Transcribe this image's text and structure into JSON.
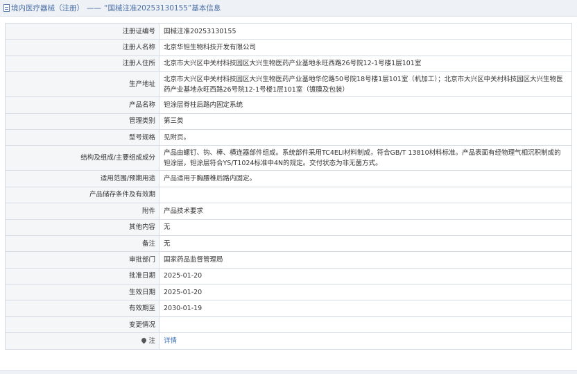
{
  "header": {
    "icon": "document-icon",
    "category": "境内医疗器械（注册）",
    "separator": "——",
    "record_title": "“国械注准20253130155”基本信息"
  },
  "rows": [
    {
      "label": "注册证编号",
      "value": "国械注准20253130155"
    },
    {
      "label": "注册人名称",
      "value": "北京华钽生物科技开发有限公司"
    },
    {
      "label": "注册人住所",
      "value": "北京市大兴区中关村科技园区大兴生物医药产业基地永旺西路26号院12-1号楼1层101室"
    },
    {
      "label": "生产地址",
      "value": "北京市大兴区中关村科技园区大兴生物医药产业基地华佗路50号院18号楼1层101室（机加工）；北京市大兴区中关村科技园区大兴生物医药产业基地永旺西路26号院12-1号楼1层101室（镀膜及包装）"
    },
    {
      "label": "产品名称",
      "value": "钽涂层脊柱后路内固定系统"
    },
    {
      "label": "管理类别",
      "value": "第三类"
    },
    {
      "label": "型号规格",
      "value": "见附页。"
    },
    {
      "label": "结构及组成/主要组成成分",
      "value": "产品由螺钉、钩、棒、横连器部件组成。系统部件采用TC4ELI材料制成，符合GB/T 13810材料标准。产品表面有经物理气相沉积制成的钽涂层，钽涂层符合YS/T1024标准中4N的规定。交付状态为非无菌方式。"
    },
    {
      "label": "适用范围/预期用途",
      "value": "产品适用于胸腰椎后路内固定。"
    },
    {
      "label": "产品储存条件及有效期",
      "value": ""
    },
    {
      "label": "附件",
      "value": "产品技术要求"
    },
    {
      "label": "其他内容",
      "value": "无"
    },
    {
      "label": "备注",
      "value": "无"
    },
    {
      "label": "审批部门",
      "value": "国家药品监督管理局"
    },
    {
      "label": "批准日期",
      "value": "2025-01-20"
    },
    {
      "label": "生效日期",
      "value": "2025-01-20"
    },
    {
      "label": "有效期至",
      "value": "2030-01-19"
    },
    {
      "label": "变更情况",
      "value": ""
    }
  ],
  "note_row": {
    "icon": "map-pin-icon",
    "label": "注",
    "link_text": "详情"
  },
  "colors": {
    "header_bg": "#eef1f6",
    "header_text": "#4a6fa5",
    "label_bg": "#f5f6f8",
    "border": "#d6dbe3",
    "link": "#3a6fb7"
  }
}
